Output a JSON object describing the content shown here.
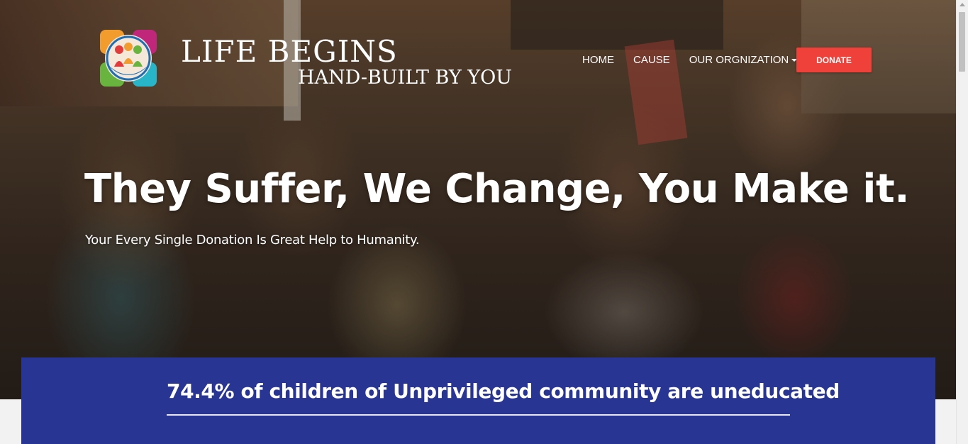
{
  "brand": {
    "title": "LIFE BEGINS",
    "subtitle": "HAND-BUILT BY YOU",
    "logo_icon": "family-hands-icon",
    "colors": {
      "orange": "#f39c2e",
      "teal": "#28b5c9",
      "magenta": "#c0267a",
      "blue": "#1f6fb5",
      "green": "#69b43e",
      "red": "#e23b3b"
    }
  },
  "nav": {
    "items": [
      {
        "label": "HOME"
      },
      {
        "label": "CAUSE"
      },
      {
        "label": "OUR ORGNIZATION"
      }
    ],
    "dropdown_icon": "caret-down-icon",
    "donate_label": "DONATE"
  },
  "hero": {
    "headline": "They Suffer, We Change, You Make it.",
    "subheadline": "Your Every Single Donation Is Great Help to Humanity."
  },
  "stat": {
    "text": "74.4% of children of Unprivileged community are uneducated"
  },
  "colors": {
    "donate_button": "#f0403a",
    "stat_panel": "#283593",
    "text": "#ffffff"
  }
}
